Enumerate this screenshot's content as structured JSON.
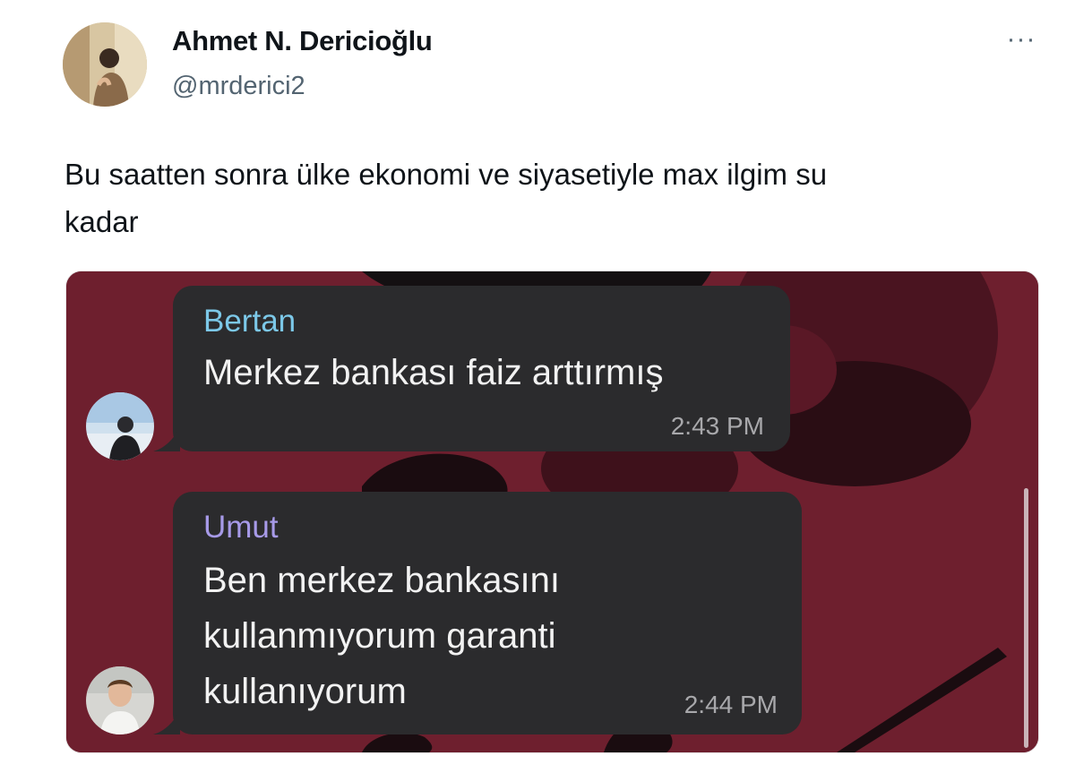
{
  "tweet": {
    "author_name": "Ahmet N. Dericioğlu",
    "author_handle": "@mrderici2",
    "more_icon": "more-horizontal-icon",
    "more_label": "···",
    "text_line1": "Bu saatten sonra ülke ekonomi ve siyasetiyle max ilgim su",
    "text_line2": "kadar"
  },
  "chat": {
    "messages": [
      {
        "sender": "Bertan",
        "sender_color": "#7cc8e8",
        "lines": [
          "Merkez bankası faiz arttırmış"
        ],
        "time": "2:43 PM"
      },
      {
        "sender": "Umut",
        "sender_color": "#a79ae8",
        "lines": [
          "Ben merkez bankasını",
          "kullanmıyorum garanti",
          "kullanıyorum"
        ],
        "time": "2:44 PM"
      }
    ],
    "background_color": "#6e1f2e",
    "bubble_color": "#2b2b2d"
  }
}
